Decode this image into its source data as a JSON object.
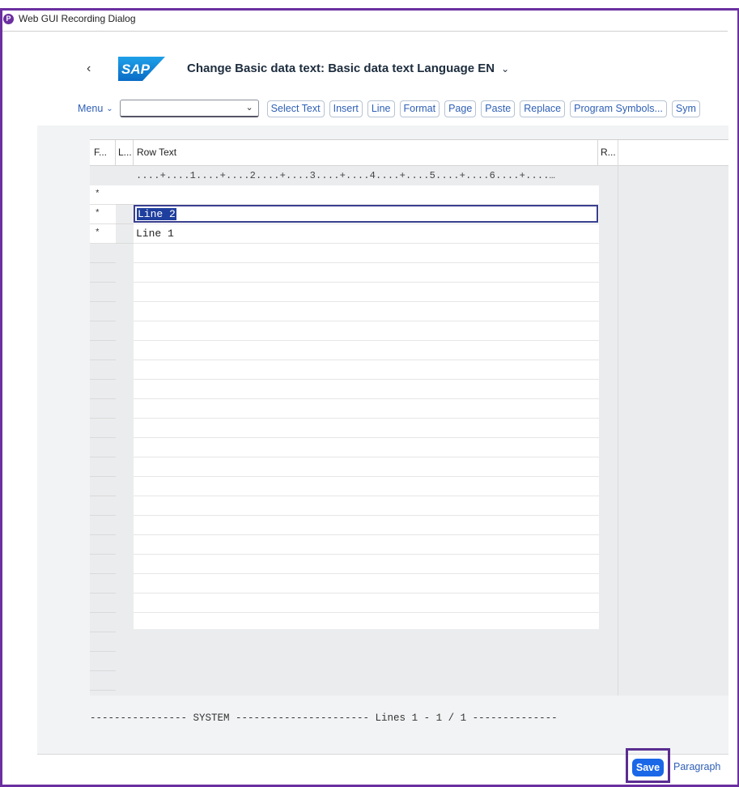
{
  "window": {
    "title": "Web GUI Recording Dialog"
  },
  "header": {
    "title": "Change Basic data text: Basic data text Language EN"
  },
  "toolbar": {
    "menu_label": "Menu",
    "select_value": "",
    "buttons": [
      "Select Text",
      "Insert",
      "Line",
      "Format",
      "Page",
      "Paste",
      "Replace",
      "Program Symbols...",
      "Sym"
    ]
  },
  "table": {
    "columns": {
      "format": "F...",
      "line": "L...",
      "row_text": "Row Text",
      "r": "R..."
    },
    "ruler": "....+....1....+....2....+....3....+....4....+....5....+....6....+....…",
    "format_marks": [
      "*",
      "*",
      "*"
    ],
    "rows": [
      "",
      "Line 2",
      "Line 1"
    ],
    "editing_row_text": "Line 2"
  },
  "status": {
    "text": "---------------- SYSTEM ---------------------- Lines 1 - 1 / 1 --------------"
  },
  "footer": {
    "save_label": "Save",
    "paragraph_label": "Paragraph"
  },
  "colors": {
    "accent": "#1a67e8",
    "frame": "#6b2fa0",
    "link": "#2e5fb6"
  },
  "icons": [
    "recorder-logo-icon",
    "back-icon",
    "sap-logo",
    "chevron-down-icon"
  ]
}
